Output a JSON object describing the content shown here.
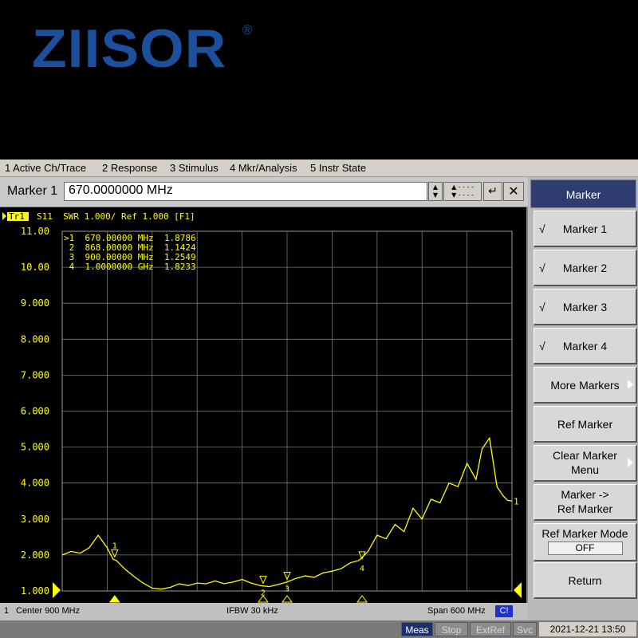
{
  "logo": {
    "text": "ZIISOR",
    "registered": "®"
  },
  "menu": [
    "1 Active Ch/Trace",
    "2 Response",
    "3 Stimulus",
    "4 Mkr/Analysis",
    "5 Instr State"
  ],
  "entry": {
    "label": "Marker 1",
    "value": "670.0000000 MHz"
  },
  "softkeys": {
    "title": "Marker",
    "items": [
      {
        "label": "Marker 1",
        "check": "√"
      },
      {
        "label": "Marker 2",
        "check": "√"
      },
      {
        "label": "Marker 3",
        "check": "√"
      },
      {
        "label": "Marker 4",
        "check": "√"
      },
      {
        "label": "More Markers"
      },
      {
        "label": "Ref Marker"
      },
      {
        "line1": "Clear Marker",
        "line2": "Menu"
      },
      {
        "line1": "Marker ->",
        "line2": "Ref Marker"
      },
      {
        "label": "Ref Marker Mode",
        "value": "OFF"
      },
      {
        "label": "Return"
      }
    ]
  },
  "trace_header": {
    "trace": "Tr1",
    "text": "S11  SWR 1.000/ Ref 1.000 [F1]"
  },
  "marker_table": [
    ">1  670.00000 MHz  1.8786",
    " 2  868.00000 MHz  1.1424",
    " 3  900.00000 MHz  1.2549",
    " 4  1.0000000 GHz  1.8233"
  ],
  "status": {
    "center": "Center 900 MHz",
    "ifbw": "IFBW 30 kHz",
    "span": "Span 600 MHz",
    "cal": "C!",
    "channel": "1"
  },
  "bottom": {
    "meas": "Meas",
    "stop": "Stop",
    "extref": "ExtRef",
    "svc": "Svc",
    "datetime": "2021-12-21 13:50"
  },
  "colors": {
    "trace": "#ffff00",
    "grid": "#7a7a7a",
    "axis_text": "#ffff00"
  },
  "chart_data": {
    "type": "line",
    "title": "",
    "xlabel": "",
    "ylabel": "",
    "xlim": [
      600,
      1200
    ],
    "ylim": [
      1,
      11
    ],
    "yticks": [
      "11.00",
      "10.00",
      "9.000",
      "8.000",
      "7.000",
      "6.000",
      "5.000",
      "4.000",
      "3.000",
      "2.000",
      "1.000"
    ],
    "x_unit": "MHz",
    "grid": true,
    "series": [
      {
        "x": [
          600,
          612,
          624,
          636,
          648,
          660,
          668,
          672,
          684,
          696,
          708,
          720,
          732,
          744,
          756,
          768,
          780,
          792,
          804,
          816,
          828,
          840,
          852,
          864,
          876,
          888,
          900,
          912,
          924,
          936,
          948,
          960,
          972,
          984,
          996,
          1008,
          1020,
          1032,
          1044,
          1056,
          1068,
          1080,
          1092,
          1104,
          1116,
          1128,
          1140,
          1152,
          1160,
          1170,
          1180,
          1188,
          1194,
          1200
        ],
        "y": [
          2.0,
          2.1,
          2.05,
          2.2,
          2.55,
          2.2,
          1.88,
          1.85,
          1.6,
          1.4,
          1.22,
          1.08,
          1.05,
          1.1,
          1.2,
          1.15,
          1.22,
          1.2,
          1.28,
          1.2,
          1.25,
          1.32,
          1.22,
          1.15,
          1.12,
          1.18,
          1.25,
          1.35,
          1.42,
          1.38,
          1.5,
          1.55,
          1.62,
          1.78,
          1.85,
          2.1,
          2.55,
          2.45,
          2.85,
          2.65,
          3.3,
          3.0,
          3.55,
          3.45,
          4.0,
          3.9,
          4.55,
          4.1,
          4.95,
          5.25,
          3.9,
          3.65,
          3.52,
          3.5
        ]
      }
    ],
    "markers": [
      {
        "id": "1",
        "x": 670,
        "y": 1.8786
      },
      {
        "id": "2",
        "x": 868,
        "y": 1.1424
      },
      {
        "id": "3",
        "x": 900,
        "y": 1.2549
      },
      {
        "id": "4",
        "x": 1000,
        "y": 1.8233
      }
    ]
  }
}
